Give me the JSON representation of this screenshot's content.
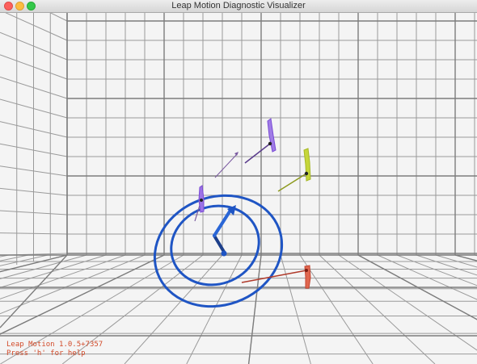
{
  "window": {
    "title": "Leap Motion Diagnostic Visualizer"
  },
  "overlay": {
    "version_line": "Leap Motion 1.0.5+7357",
    "help_line": "Press 'h' for help"
  },
  "colors": {
    "background": "#f4f4f4",
    "grid": "#9a9a9a",
    "circle_gesture": "#1f55c4",
    "pointable_purple": "#8c55d8",
    "pointable_yellow": "#b7c92b",
    "pointable_red": "#d24a3a",
    "status_text": "#d24b2a"
  },
  "scene": {
    "icons": [
      "circle-gesture",
      "hand-palm",
      "finger-pointables"
    ]
  }
}
